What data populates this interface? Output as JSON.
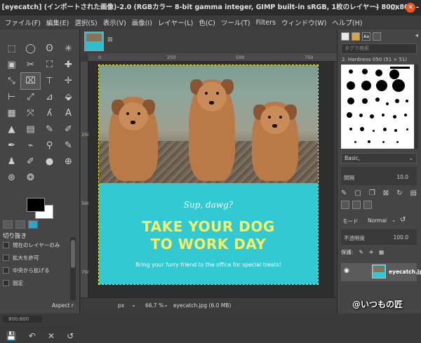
{
  "window": {
    "title": "[eyecatch] (インポートされた画像)-2.0 (RGBカラー 8-bit gamma integer, GIMP built-in sRGB, 1枚のレイヤー) 800x800 – GIMP",
    "minimize": "–",
    "maximize": "□",
    "close": "✕"
  },
  "menu": [
    "ファイル(F)",
    "編集(E)",
    "選択(S)",
    "表示(V)",
    "画像(I)",
    "レイヤー(L)",
    "色(C)",
    "ツール(T)",
    "Filters",
    "ウィンドウ(W)",
    "ヘルプ(H)"
  ],
  "toolbox": {
    "tools": [
      "⬚",
      "◯",
      "ʘ",
      "✳",
      "▣",
      "✂",
      "⛶",
      "✚",
      "⤡",
      "⌧",
      "⊤",
      "✛",
      "⊢",
      "⤢",
      "⊿",
      "⬙",
      "▦",
      "⤧",
      "ʎ",
      "A",
      "▲",
      "▤",
      "✎",
      "✐",
      "✒",
      "⌁",
      "⚲",
      "✎",
      "♟",
      "✐",
      "●",
      "⊕",
      "⊛",
      "❂"
    ],
    "tool_options_title": "切り抜き",
    "options": [
      "現在のレイヤーのみ",
      "拡大を許可",
      "中央から拡げる",
      "固定"
    ],
    "aspect": "Aspect r",
    "position": "800:800",
    "bottom_icons": [
      "💾",
      "↶",
      "✕",
      "↺"
    ]
  },
  "canvas": {
    "hruler_ticks": [
      "0",
      "250",
      "500",
      "750"
    ],
    "vruler_ticks": [
      "250",
      "500",
      "750"
    ],
    "sup": "Sup, dawg?",
    "headline_1": "TAKE YOUR DOG",
    "headline_2": "TO WORK DAY",
    "subtitle": "Bring your furry friend to the office for special treats!"
  },
  "statusbar": {
    "unit": "px",
    "zoom": "66.7 %",
    "file": "eyecatch.jpg (6.0 MB)"
  },
  "dock": {
    "tag_placeholder": "タグで検索",
    "brush_name": "2. Hardness 050 (51 × 51)",
    "preset": "Basic,",
    "spacing_label": "間隔",
    "spacing_value": "10.0",
    "mode_label": "モード",
    "mode_value": "Normal",
    "opacity_label": "不透明度",
    "opacity_value": "100.0",
    "lock_label": "保護:",
    "layer_name": "eyecatch.jpg",
    "gradient_tab": "Aa"
  },
  "watermark": "@いつもの匠",
  "colors": {
    "banner": "#33c9d3",
    "headline": "#f4f066",
    "close_button": "#e95420",
    "foreground": "#000000",
    "background": "#ffffff"
  }
}
